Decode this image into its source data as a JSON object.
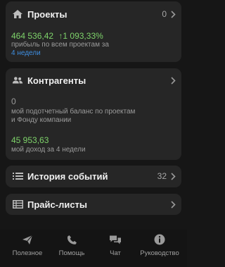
{
  "projects": {
    "title": "Проекты",
    "count": "0",
    "amount": "464 536,42",
    "change": "↑1 093,33%",
    "note": "прибыль по всем проектам за",
    "period": "4 недели"
  },
  "contractors": {
    "title": "Контрагенты",
    "balance": "0",
    "balance_note_1": "мой подотчетный баланс по проектам",
    "balance_note_2": "и Фонду компании",
    "income": "45 953,63",
    "income_note": "мой доход за 4 недели"
  },
  "history": {
    "title": "История событий",
    "count": "32"
  },
  "pricelists": {
    "title": "Прайс-листы"
  },
  "tabs": [
    {
      "label": "Полезное",
      "icon": "send-icon"
    },
    {
      "label": "Помощь",
      "icon": "phone-icon"
    },
    {
      "label": "Чат",
      "icon": "chat-icon"
    },
    {
      "label": "Руководство",
      "icon": "info-icon"
    }
  ],
  "colors": {
    "accent_green": "#7ed36a",
    "link_blue": "#3f8ee0",
    "card_bg": "#262626",
    "page_bg": "#161616"
  }
}
